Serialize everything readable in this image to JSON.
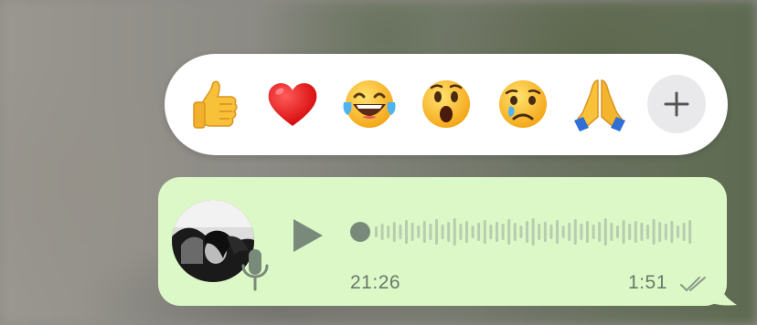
{
  "reactions": [
    {
      "emoji": "👍",
      "icon": "thumbs-up-icon"
    },
    {
      "emoji": "❤️",
      "icon": "red-heart-icon"
    },
    {
      "emoji": "😂",
      "icon": "tears-of-joy-icon"
    },
    {
      "emoji": "😮",
      "icon": "open-mouth-icon"
    },
    {
      "emoji": "😢",
      "icon": "crying-face-icon"
    },
    {
      "emoji": "🙏",
      "icon": "folded-hands-icon"
    }
  ],
  "more_reactions_icon": "plus-icon",
  "voice_message": {
    "elapsed_time": "21:26",
    "sent_time": "1:51",
    "playback_progress": 0,
    "status_icon": "double-check-icon",
    "bubble_color": "#dcf8c6"
  },
  "colors": {
    "reaction_bar": "#ffffff",
    "accent_gray": "#7a8a7a"
  }
}
